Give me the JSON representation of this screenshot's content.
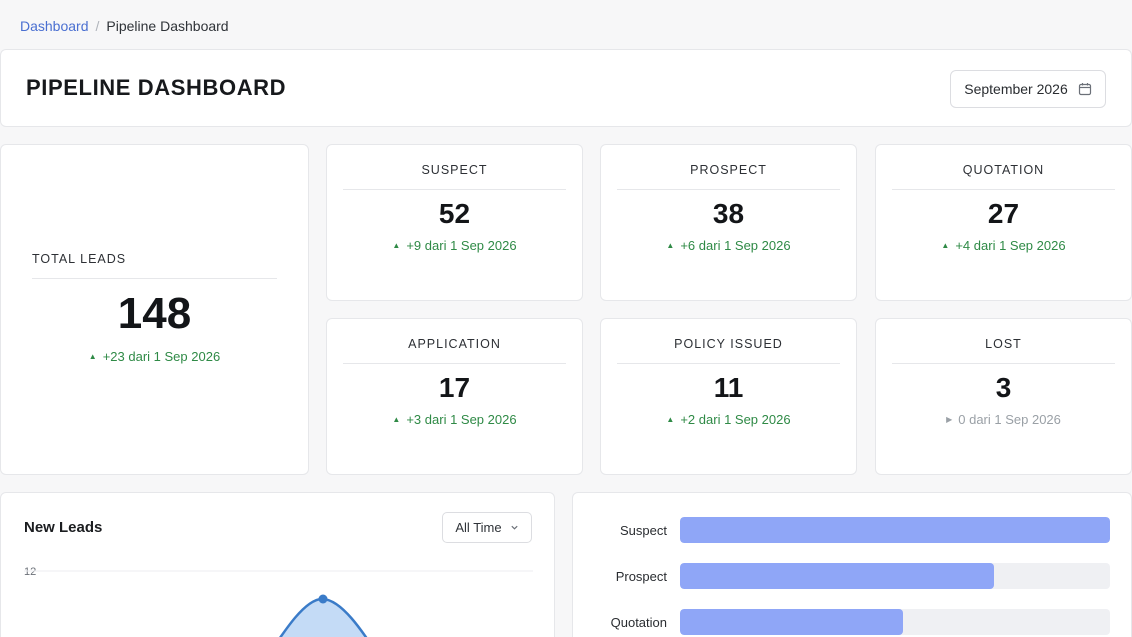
{
  "breadcrumb": {
    "home": "Dashboard",
    "current": "Pipeline Dashboard"
  },
  "header": {
    "title": "PIPELINE DASHBOARD",
    "month": "September 2026"
  },
  "total": {
    "label": "TOTAL LEADS",
    "value": "148",
    "delta": "+23 dari 1 Sep 2026"
  },
  "stats": [
    {
      "label": "SUSPECT",
      "value": "52",
      "delta": "+9 dari 1 Sep 2026",
      "trend": "up"
    },
    {
      "label": "PROSPECT",
      "value": "38",
      "delta": "+6 dari 1 Sep 2026",
      "trend": "up"
    },
    {
      "label": "QUOTATION",
      "value": "27",
      "delta": "+4 dari 1 Sep 2026",
      "trend": "up"
    },
    {
      "label": "APPLICATION",
      "value": "17",
      "delta": "+3 dari 1 Sep 2026",
      "trend": "up"
    },
    {
      "label": "POLICY ISSUED",
      "value": "11",
      "delta": "+2 dari 1 Sep 2026",
      "trend": "up"
    },
    {
      "label": "LOST",
      "value": "3",
      "delta": "0 dari 1 Sep 2026",
      "trend": "flat"
    }
  ],
  "new_leads": {
    "title": "New Leads",
    "range": "All Time",
    "y_tick": "12"
  },
  "funnel": [
    {
      "label": "Suspect",
      "value": 52
    },
    {
      "label": "Prospect",
      "value": 38
    },
    {
      "label": "Quotation",
      "value": 27
    }
  ],
  "colors": {
    "accent": "#4a6fd1",
    "up": "#2f8a46",
    "flat": "#9aa0a6",
    "bar": "#8fa6f7",
    "area": "#c4dbf6",
    "line": "#3a7bc8"
  }
}
